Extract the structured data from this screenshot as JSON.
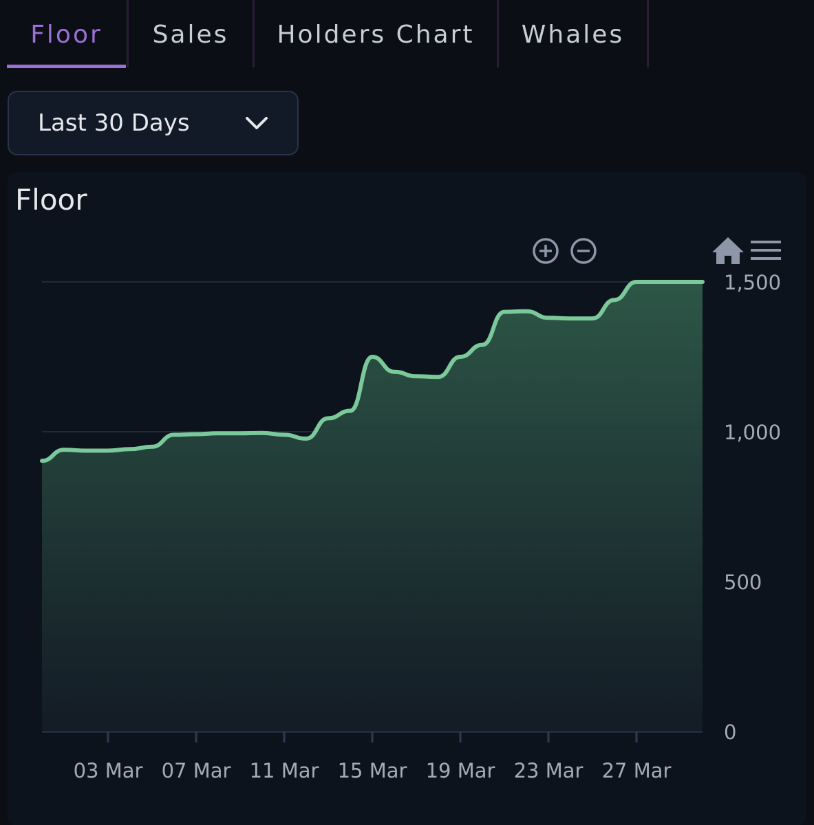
{
  "tabs": [
    {
      "label": "Floor",
      "active": true
    },
    {
      "label": "Sales",
      "active": false
    },
    {
      "label": "Holders Chart",
      "active": false
    },
    {
      "label": "Whales",
      "active": false
    }
  ],
  "range_select": {
    "selected": "Last 30 Days"
  },
  "chart_title": "Floor",
  "toolbar_icons": [
    "zoom-in-icon",
    "zoom-out-icon",
    "home-icon",
    "menu-icon"
  ],
  "colors": {
    "accent": "#9b6fd6",
    "line": "#7bc99a",
    "background": "#0b0e15",
    "card": "#0d131d"
  },
  "chart_data": {
    "type": "area",
    "title": "Floor",
    "xlabel": "",
    "ylabel": "",
    "ylim": [
      0,
      1500
    ],
    "yticks": [
      0,
      500,
      1000,
      1500
    ],
    "ytick_labels": [
      "0",
      "500",
      "1,000",
      "1,500"
    ],
    "y_axis_position": "right",
    "xlim": [
      "2023-02-28",
      "2023-03-30"
    ],
    "xticks": [
      "2023-03-03",
      "2023-03-07",
      "2023-03-11",
      "2023-03-15",
      "2023-03-19",
      "2023-03-23",
      "2023-03-27"
    ],
    "xtick_labels": [
      "03 Mar",
      "07 Mar",
      "11 Mar",
      "15 Mar",
      "19 Mar",
      "23 Mar",
      "27 Mar"
    ],
    "grid": true,
    "legend": "none",
    "series": [
      {
        "name": "Floor",
        "x": [
          "2023-02-28",
          "2023-03-01",
          "2023-03-02",
          "2023-03-03",
          "2023-03-04",
          "2023-03-05",
          "2023-03-06",
          "2023-03-07",
          "2023-03-08",
          "2023-03-09",
          "2023-03-10",
          "2023-03-11",
          "2023-03-12",
          "2023-03-13",
          "2023-03-14",
          "2023-03-15",
          "2023-03-16",
          "2023-03-17",
          "2023-03-18",
          "2023-03-19",
          "2023-03-20",
          "2023-03-21",
          "2023-03-22",
          "2023-03-23",
          "2023-03-24",
          "2023-03-25",
          "2023-03-26",
          "2023-03-27",
          "2023-03-28",
          "2023-03-29",
          "2023-03-30"
        ],
        "values": [
          903,
          940,
          937,
          937,
          942,
          950,
          990,
          992,
          995,
          995,
          996,
          990,
          977,
          1045,
          1070,
          1250,
          1200,
          1185,
          1183,
          1250,
          1290,
          1400,
          1402,
          1380,
          1378,
          1378,
          1440,
          1500,
          1500,
          1500,
          1500
        ]
      }
    ]
  }
}
